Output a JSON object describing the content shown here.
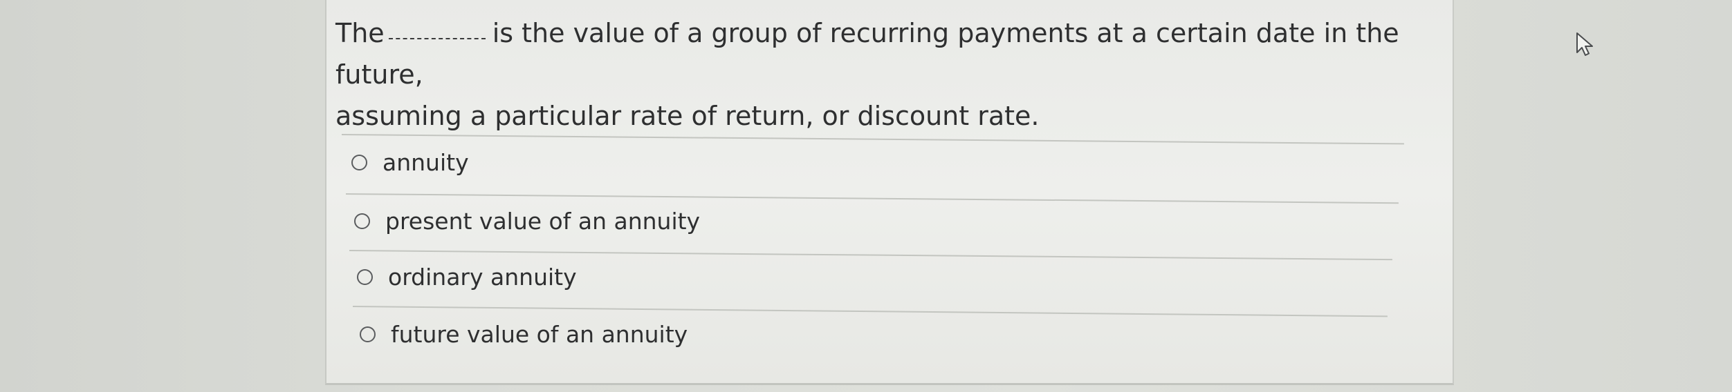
{
  "question": {
    "text_before_blank": "The",
    "blank_label": "blank",
    "text_after_blank": "is the value of a group of recurring payments at a certain date in the future,",
    "text_line2": "assuming a particular rate of return, or discount rate."
  },
  "options": [
    {
      "label": "annuity",
      "selected": false
    },
    {
      "label": "present value of an annuity",
      "selected": false
    },
    {
      "label": "ordinary annuity",
      "selected": false
    },
    {
      "label": "future value of an annuity",
      "selected": false
    }
  ],
  "colors": {
    "text": "#2e2f30",
    "card_background": "#eceeeb",
    "page_background": "#dcded9",
    "divider": "#c3c5c0",
    "radio_border": "#5a5c5e"
  },
  "icons": {
    "cursor": "mouse-pointer-icon",
    "radio": "radio-button-icon"
  }
}
